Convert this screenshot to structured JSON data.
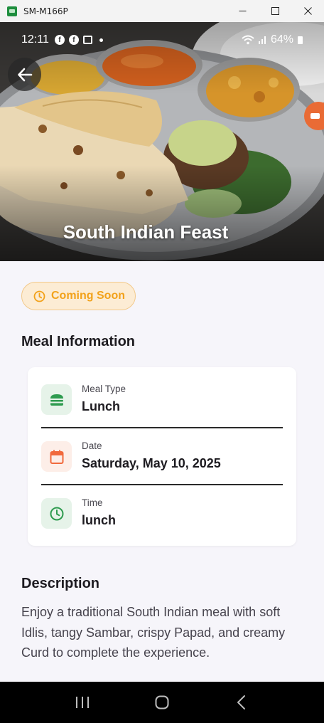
{
  "window": {
    "title": "SM-M166P",
    "minimize_glyph": "—",
    "maximize_glyph": "☐",
    "close_glyph": "✕"
  },
  "status_bar": {
    "time": "12:11",
    "battery": "64%"
  },
  "hero": {
    "title": "South Indian Feast"
  },
  "badge": {
    "label": "Coming Soon",
    "color": "#f2a21b"
  },
  "meal_info": {
    "heading": "Meal Information",
    "items": [
      {
        "label": "Meal Type",
        "value": "Lunch",
        "icon": "burger-icon",
        "accent": "#2e9b4f"
      },
      {
        "label": "Date",
        "value": "Saturday, May 10, 2025",
        "icon": "calendar-icon",
        "accent": "#f1693c"
      },
      {
        "label": "Time",
        "value": "lunch",
        "icon": "clock-icon",
        "accent": "#2e9b4f"
      }
    ]
  },
  "description": {
    "heading": "Description",
    "text": "Enjoy a traditional South Indian meal with soft Idlis, tangy Sambar, crispy Papad, and creamy Curd to complete the experience."
  },
  "nav": {
    "recents": "recents-icon",
    "home": "home-icon",
    "back": "back-icon"
  }
}
